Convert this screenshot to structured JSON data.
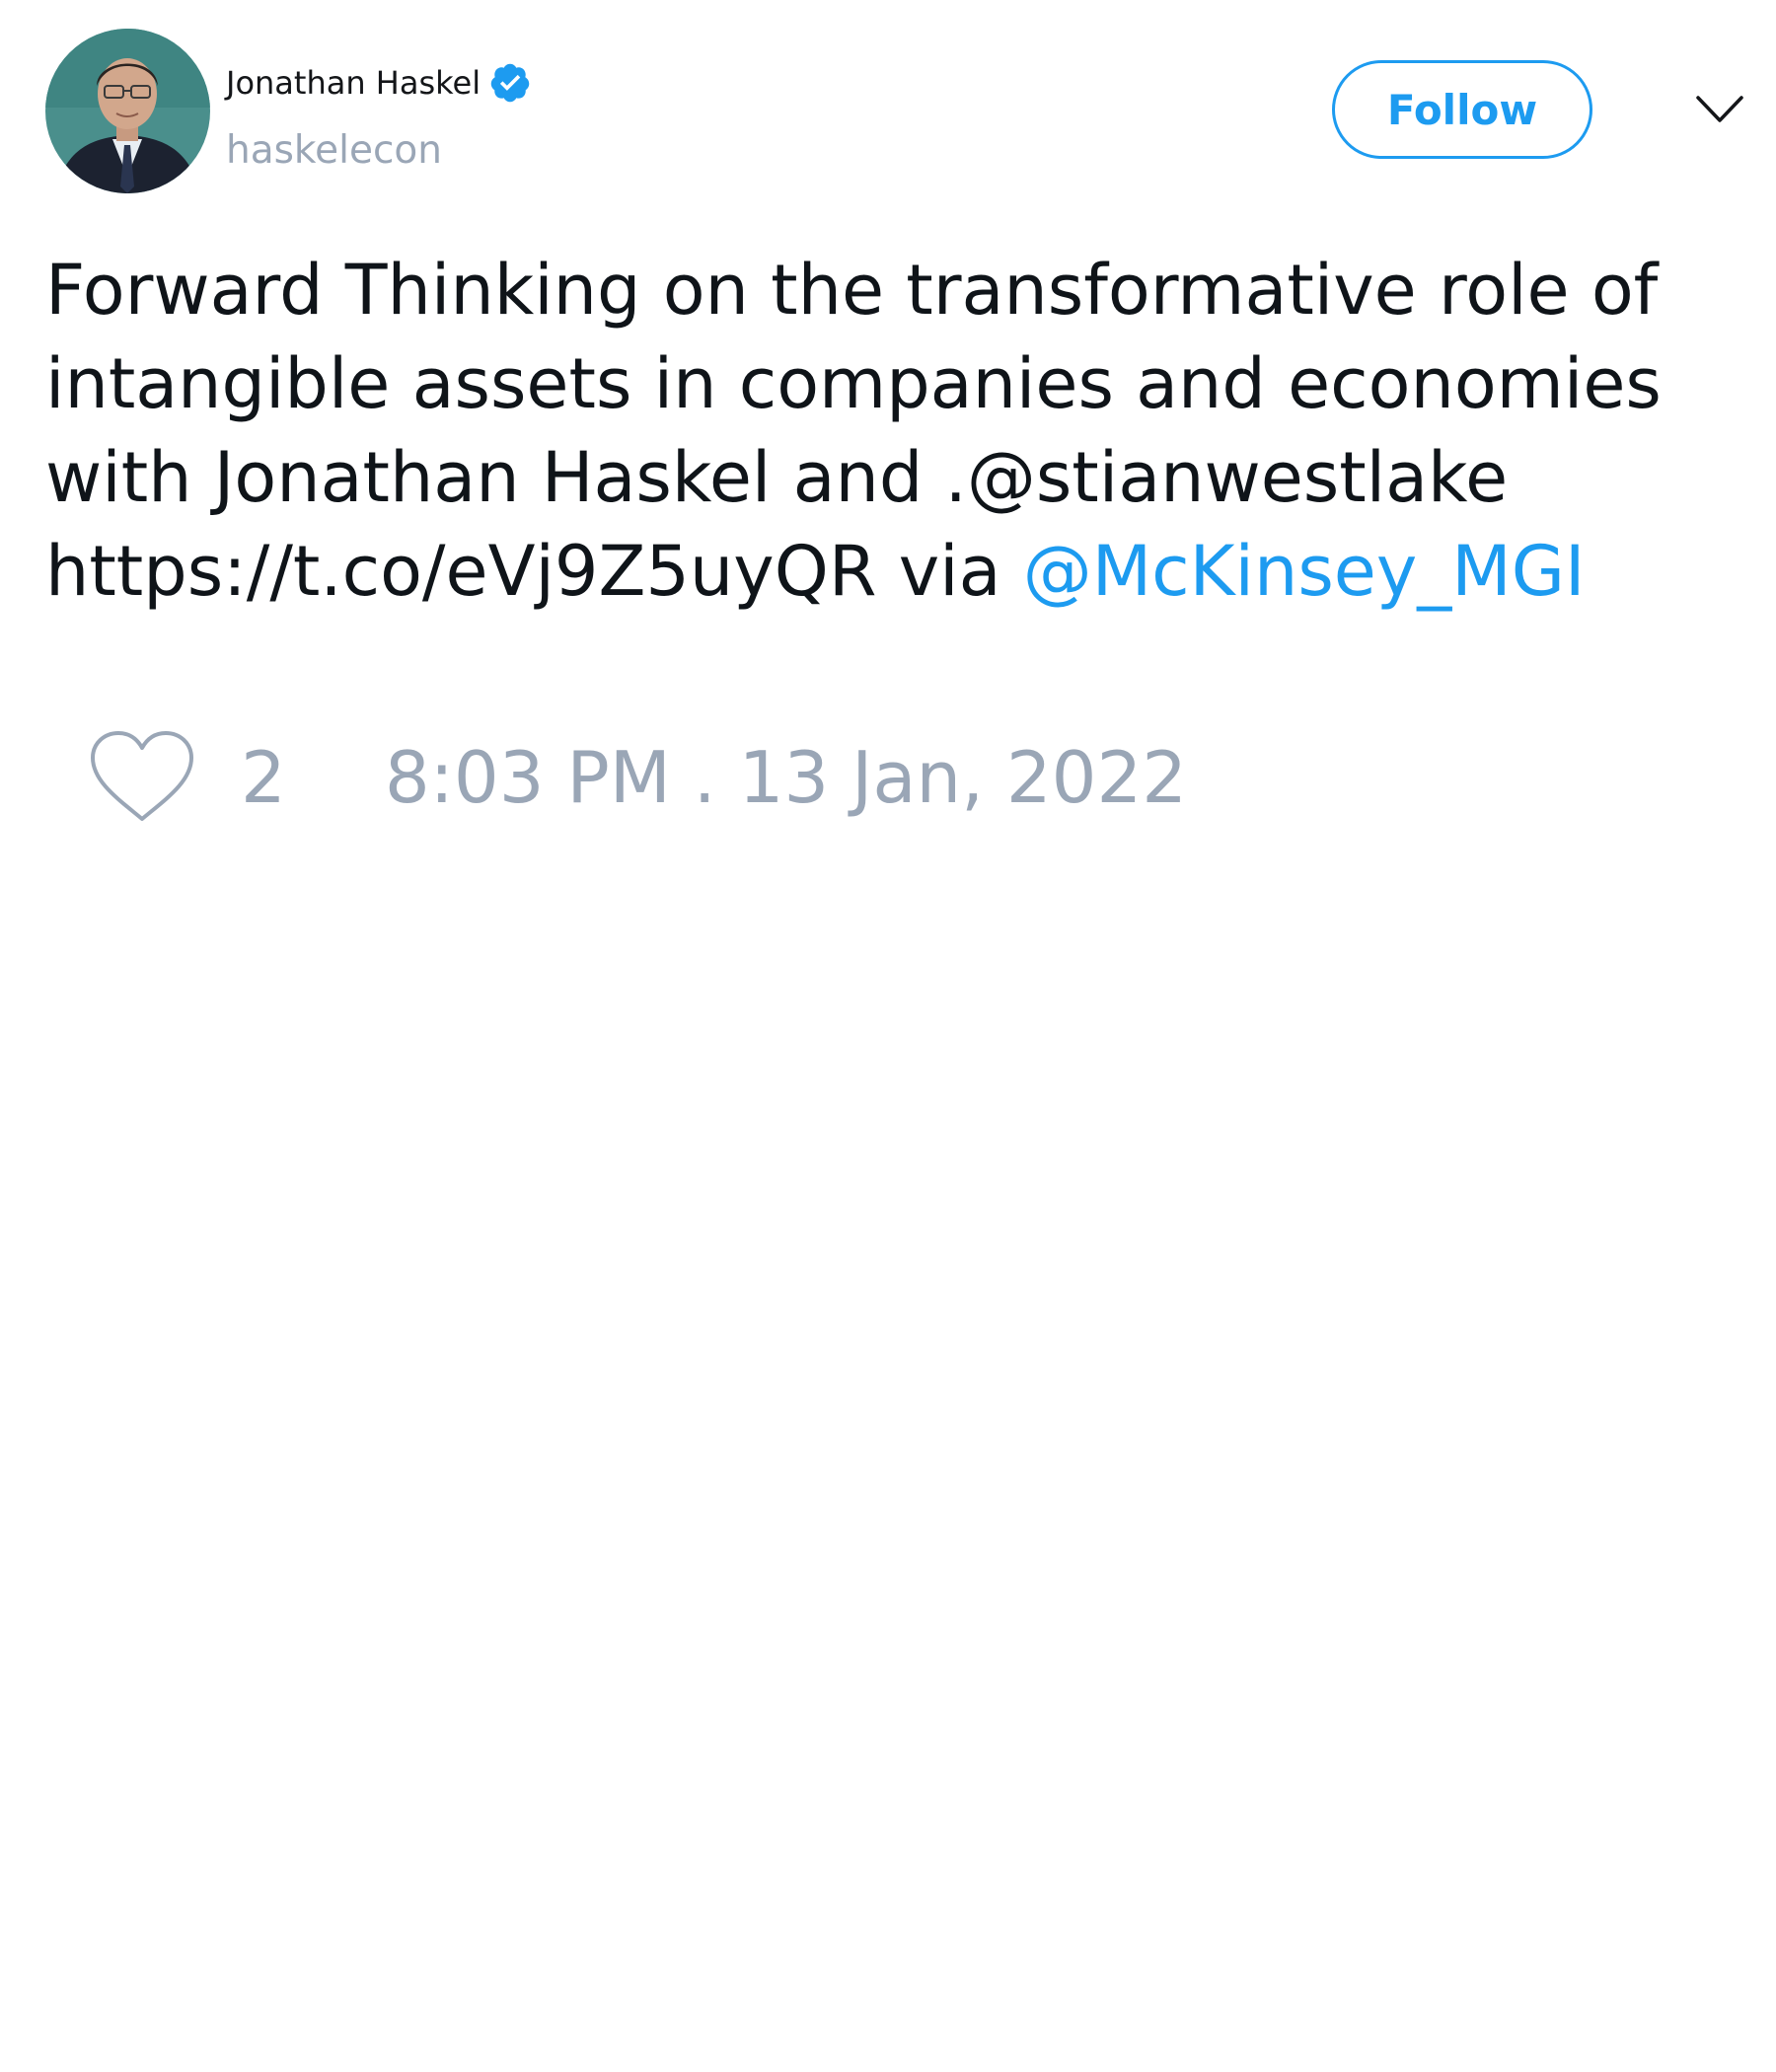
{
  "author": {
    "display_name": "Jonathan Haskel",
    "handle": "haskelecon",
    "verified": true
  },
  "follow_button": {
    "label": "Follow"
  },
  "tweet": {
    "lines": [
      "Forward Thinking on the transformative role of",
      "intangible assets in companies and economies",
      "with Jonathan Haskel and .@stianwestlake",
      "https://t.co/eVj9Z5uyQR via "
    ],
    "mention": "@McKinsey_MGI"
  },
  "footer": {
    "like_count": "2",
    "timestamp": "8:03 PM . 13 Jan, 2022"
  },
  "colors": {
    "accent": "#1d9bf0",
    "muted": "#9aa6b6",
    "text": "#0f1419"
  },
  "icons": {
    "verified": "verified-badge-icon",
    "more": "chevron-down-icon",
    "like": "heart-outline-icon"
  }
}
